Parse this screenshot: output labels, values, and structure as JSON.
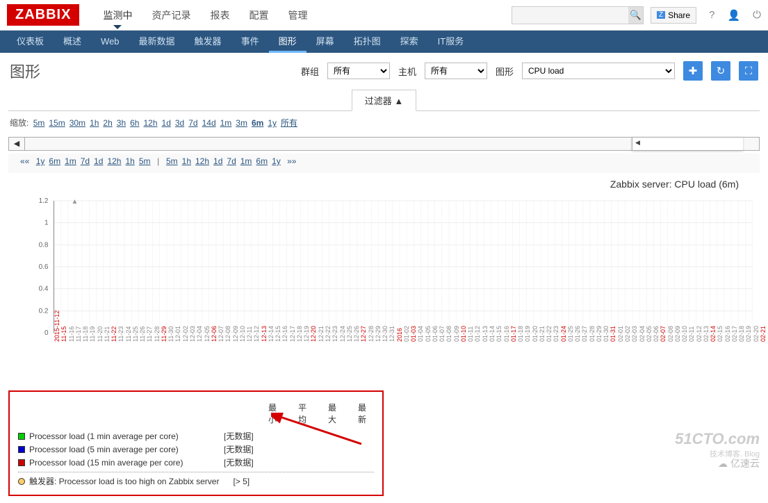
{
  "logo": "ZABBIX",
  "topnav": [
    "监测中",
    "资产记录",
    "报表",
    "配置",
    "管理"
  ],
  "topnav_active": 0,
  "share_label": "Share",
  "subnav": [
    "仪表板",
    "概述",
    "Web",
    "最新数据",
    "触发器",
    "事件",
    "图形",
    "屏幕",
    "拓扑图",
    "探索",
    "IT服务"
  ],
  "subnav_active": 6,
  "page_title": "图形",
  "filters": {
    "group_label": "群组",
    "group_value": "所有",
    "host_label": "主机",
    "host_value": "所有",
    "graph_label": "图形",
    "graph_value": "CPU load"
  },
  "filter_tab": "过滤器 ▲",
  "zoom_label": "缩放:",
  "zoom_items": [
    "5m",
    "15m",
    "30m",
    "1h",
    "2h",
    "3h",
    "6h",
    "12h",
    "1d",
    "3d",
    "7d",
    "14d",
    "1m",
    "3m",
    "6m",
    "1y",
    "所有"
  ],
  "zoom_active": "6m",
  "nav_left_marker": "««",
  "nav_right_marker": "»»",
  "nav_left": [
    "1y",
    "6m",
    "1m",
    "7d",
    "1d",
    "12h",
    "1h",
    "5m"
  ],
  "nav_right": [
    "5m",
    "1h",
    "12h",
    "1d",
    "7d",
    "1m",
    "6m",
    "1y"
  ],
  "chart_data": {
    "type": "line",
    "title": "Zabbix server: CPU load (6m)",
    "ylabel": "",
    "ylim": [
      0,
      1.2
    ],
    "yticks": [
      0,
      0.2,
      0.4,
      0.6,
      0.8,
      1.0,
      1.2
    ],
    "xrange": [
      "2015-11-12",
      "2016-02-21"
    ],
    "xticks": [
      "2015-11-12",
      "11-15",
      "11-16",
      "11-17",
      "11-18",
      "11-19",
      "11-20",
      "11-21",
      "11-22",
      "11-23",
      "11-24",
      "11-25",
      "11-26",
      "11-27",
      "11-28",
      "11-29",
      "11-30",
      "12-01",
      "12-02",
      "12-03",
      "12-04",
      "12-05",
      "12-06",
      "12-07",
      "12-08",
      "12-09",
      "12-10",
      "12-11",
      "12-12",
      "12-13",
      "12-14",
      "12-15",
      "12-16",
      "12-17",
      "12-18",
      "12-19",
      "12-20",
      "12-21",
      "12-22",
      "12-23",
      "12-24",
      "12-25",
      "12-26",
      "12-27",
      "12-28",
      "12-29",
      "12-30",
      "12-31",
      "2016",
      "01-02",
      "01-03",
      "01-04",
      "01-05",
      "01-06",
      "01-07",
      "01-08",
      "01-09",
      "01-10",
      "01-11",
      "01-12",
      "01-13",
      "01-14",
      "01-15",
      "01-16",
      "01-17",
      "01-18",
      "01-19",
      "01-20",
      "01-21",
      "01-22",
      "01-23",
      "01-24",
      "01-25",
      "01-26",
      "01-27",
      "01-28",
      "01-29",
      "01-30",
      "01-31",
      "02-01",
      "02-02",
      "02-03",
      "02-04",
      "02-05",
      "02-06",
      "02-07",
      "02-08",
      "02-09",
      "02-10",
      "02-11",
      "02-12",
      "02-13",
      "02-14",
      "02-15",
      "02-16",
      "02-17",
      "02-18",
      "02-19",
      "02-20",
      "02-21"
    ],
    "xticks_highlight": [
      "2015-11-12",
      "11-15",
      "11-22",
      "11-29",
      "12-06",
      "12-13",
      "12-20",
      "12-27",
      "2016",
      "01-03",
      "01-10",
      "01-17",
      "01-24",
      "01-31",
      "02-07",
      "02-14",
      "02-21"
    ],
    "series": [
      {
        "name": "Processor load (1 min average per core)",
        "color": "#00cc00",
        "values": []
      },
      {
        "name": "Processor load (5 min average per core)",
        "color": "#0000cc",
        "values": []
      },
      {
        "name": "Processor load (15 min average per core)",
        "color": "#cc0000",
        "values": []
      }
    ],
    "legend_headers": [
      "最小",
      "平均",
      "最大",
      "最新"
    ],
    "legend_values": [
      "[无数据]",
      "[无数据]",
      "[无数据]"
    ],
    "trigger": {
      "label": "触发器: Processor load is too high on Zabbix server",
      "threshold": "[> 5]",
      "color": "#ffcc66"
    }
  },
  "watermark": {
    "a": "51CTO.com",
    "b": "技术博客. Blog",
    "c": "亿速云"
  }
}
